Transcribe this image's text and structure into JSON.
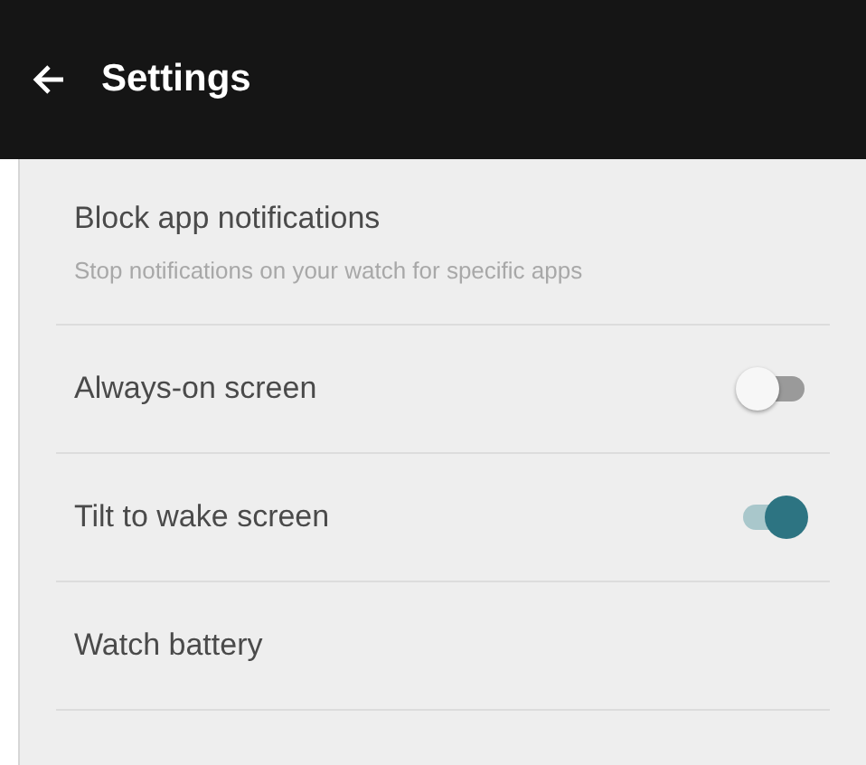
{
  "app_bar": {
    "title": "Settings"
  },
  "items": [
    {
      "kind": "text",
      "title": "Block app notifications",
      "subtitle": "Stop notifications on your watch for specific apps"
    },
    {
      "kind": "toggle",
      "title": "Always-on screen",
      "on": false
    },
    {
      "kind": "toggle",
      "title": "Tilt to wake screen",
      "on": true
    },
    {
      "kind": "text",
      "title": "Watch battery"
    }
  ]
}
